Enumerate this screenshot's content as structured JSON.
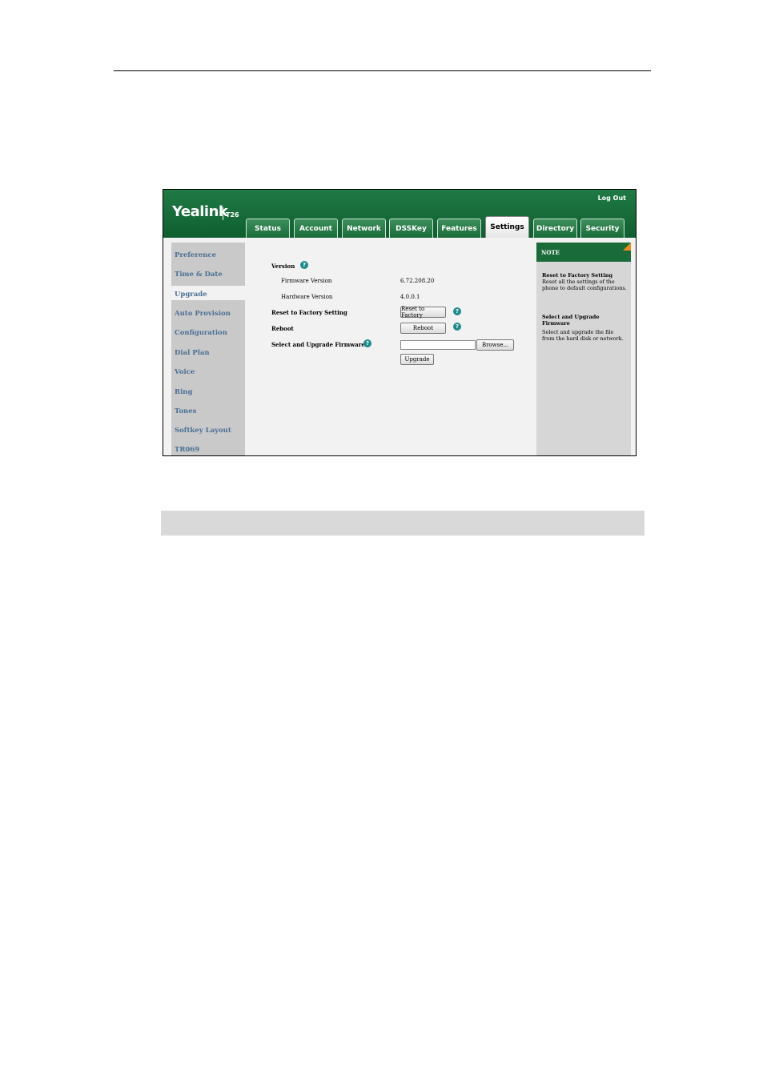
{
  "app": {
    "brand": "Yealink",
    "model": "T26",
    "logout": "Log Out"
  },
  "tabs": [
    {
      "label": "Status"
    },
    {
      "label": "Account"
    },
    {
      "label": "Network"
    },
    {
      "label": "DSSKey"
    },
    {
      "label": "Features"
    },
    {
      "label": "Settings",
      "active": true
    },
    {
      "label": "Directory"
    },
    {
      "label": "Security"
    }
  ],
  "sidebar": [
    {
      "label": "Preference"
    },
    {
      "label": "Time & Date"
    },
    {
      "label": "Upgrade",
      "active": true
    },
    {
      "label": "Auto Provision"
    },
    {
      "label": "Configuration"
    },
    {
      "label": "Dial Plan"
    },
    {
      "label": "Voice"
    },
    {
      "label": "Ring"
    },
    {
      "label": "Tones"
    },
    {
      "label": "Softkey Layout"
    },
    {
      "label": "TR069"
    }
  ],
  "content": {
    "version_label": "Version",
    "firmware_label": "Firmware Version",
    "firmware_value": "6.72.208.20",
    "hardware_label": "Hardware Version",
    "hardware_value": "4.0.0.1",
    "reset_label": "Reset to Factory Setting",
    "reset_button": "Reset to Factory",
    "reboot_label": "Reboot",
    "reboot_button": "Reboot",
    "upgrade_label": "Select and Upgrade Firmware",
    "browse_button": "Browse...",
    "upgrade_button": "Upgrade",
    "help_glyph": "?"
  },
  "note": {
    "heading": "NOTE",
    "items": [
      {
        "title": "Reset to Factory Setting",
        "text": "Reset all the settings of the phone to default configurations."
      },
      {
        "title": "Select and Upgrade Firmware",
        "text": "Select and upgrade the file from the hard disk or network."
      }
    ]
  },
  "colors": {
    "brand_green": "#1a6b3a",
    "link_blue": "#4a6f94",
    "help_teal": "#1e8a8a",
    "note_corner": "#f08a1c"
  }
}
